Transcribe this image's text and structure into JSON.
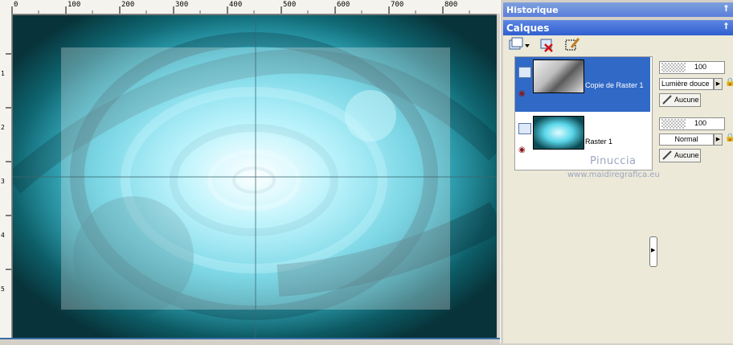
{
  "ruler": {
    "top_labels": [
      "0",
      "100",
      "200",
      "300",
      "400",
      "500",
      "600",
      "700",
      "800"
    ],
    "left_labels": [
      "1",
      "2",
      "3",
      "4",
      "5"
    ]
  },
  "panels": {
    "historique": {
      "title": "Historique",
      "pin": "✓"
    },
    "calques": {
      "title": "Calques",
      "pin": "✓"
    }
  },
  "toolbar": {
    "icons": [
      "new-layer-icon",
      "delete-layer-icon",
      "mask-edit-icon"
    ]
  },
  "layers": [
    {
      "name": "Copie de Raster 1",
      "selected": true,
      "opacity": "100",
      "blend_mode": "Lumière douce",
      "mask_label": "Aucune"
    },
    {
      "name": "Raster 1",
      "selected": false,
      "opacity": "100",
      "blend_mode": "Normal",
      "mask_label": "Aucune"
    }
  ],
  "watermark": {
    "name": "Pinuccia",
    "url": "www.maidiregrafica.eu"
  },
  "colors": {
    "selection": "#3169c6",
    "panel_header": "#2f5fd0",
    "canvas_bg": "#0f3c42",
    "accent_cyan": "#4fd8ee"
  }
}
